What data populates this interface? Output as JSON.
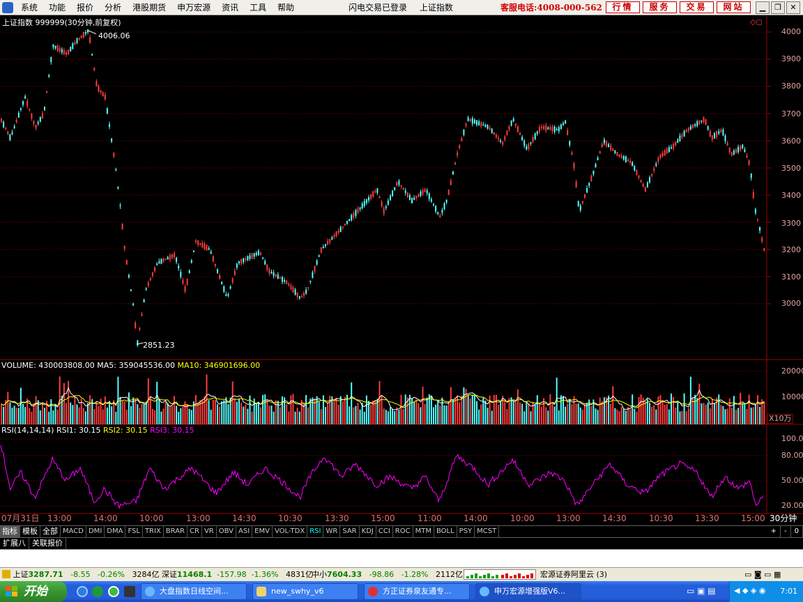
{
  "menubar": {
    "items": [
      "系统",
      "功能",
      "报价",
      "分析",
      "港股期货",
      "申万宏源",
      "资讯",
      "工具",
      "帮助"
    ],
    "status": [
      "闪电交易已登录",
      "上证指数"
    ],
    "phone": "客服电话:4008-000-562",
    "buttons": [
      "行情",
      "服务",
      "交易",
      "网站"
    ]
  },
  "price_panel": {
    "title": "上证指数 999999(30分钟,前复权)",
    "high_label": "4006.06",
    "low_label": "2851.23",
    "y_ticks": [
      "4000",
      "3900",
      "3800",
      "3700",
      "3600",
      "3500",
      "3400",
      "3300",
      "3200",
      "3100",
      "3000"
    ]
  },
  "volume_panel": {
    "label": "VOLUME: 430003808.00",
    "ma5": "MA5: 359045536.00",
    "ma10": "MA10: 346901696.00",
    "y_ticks": [
      "20000",
      "10000"
    ],
    "unit": "X10万"
  },
  "rsi_panel": {
    "label": "RSI(14,14,14)",
    "rsi1": "RSI1: 30.15",
    "rsi2": "RSI2: 30.15",
    "rsi3": "RSI3: 30.15",
    "y_ticks": [
      "100.00",
      "80.00",
      "50.00",
      "20.00"
    ]
  },
  "time_axis": {
    "labels": [
      "07月31日",
      "13:00",
      "14:00",
      "10:00",
      "13:00",
      "14:30",
      "10:30",
      "13:30",
      "15:00",
      "11:00",
      "14:00",
      "10:00",
      "13:00",
      "14:30",
      "10:30",
      "13:30",
      "15:00"
    ],
    "period": "30分钟"
  },
  "indicator_tabs": [
    "指标",
    "模板",
    "全部",
    "MACD",
    "DMI",
    "DMA",
    "FSL",
    "TRIX",
    "BRAR",
    "CR",
    "VR",
    "OBV",
    "ASI",
    "EMV",
    "VOL-TDX",
    "RSI",
    "WR",
    "SAR",
    "KDJ",
    "CCI",
    "ROC",
    "MTM",
    "BOLL",
    "PSY",
    "MCST"
  ],
  "indicator_right": [
    "+",
    "-",
    "0"
  ],
  "sub_tabs": [
    "扩展八",
    "关联报价"
  ],
  "statusbar": {
    "sh_name": "上证",
    "sh_value": "3287.71",
    "sh_change": "-8.55",
    "sh_pct": "-0.26%",
    "sh_amount": "3284亿",
    "sz_name": "深证",
    "sz_value": "11468.1",
    "sz_change": "-157.98",
    "sz_pct": "-1.36%",
    "sz_amount": "4831亿",
    "zx_name": "中小",
    "zx_value": "7604.33",
    "zx_change": "-98.86",
    "zx_pct": "-1.28%",
    "zx_amount": "2112亿",
    "broker": "宏源证券阿里云 (3)"
  },
  "taskbar": {
    "start": "开始",
    "items": [
      "大盘指数日线空间...",
      "new_swhy_v6",
      "方正证券泉友通专...",
      "申万宏源增强版V6..."
    ],
    "clock": "7:01"
  },
  "colors": {
    "up": "#ff3c3c",
    "down": "#54ffff",
    "rsi": "#ff00ff",
    "ma5": "#ffffff",
    "ma10": "#ffff00",
    "grid": "#8a0000"
  }
}
